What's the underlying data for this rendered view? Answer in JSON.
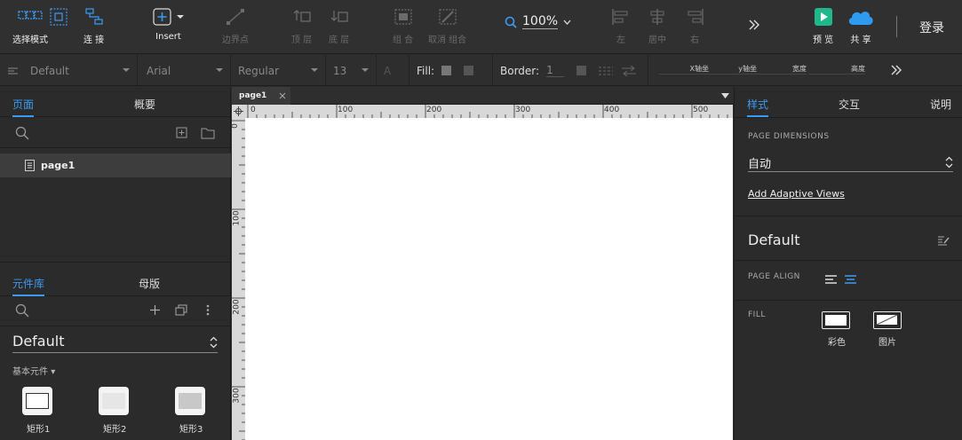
{
  "toolbar": {
    "select_mode": "选择模式",
    "connect": "连 接",
    "insert": "Insert",
    "boundary": "边界点",
    "top_layer": "顶 层",
    "bottom_layer": "底 层",
    "group": "组 合",
    "ungroup": "取消 组合",
    "zoom": "100%",
    "align_left": "左",
    "align_center": "居中",
    "align_right": "右",
    "preview": "预 览",
    "share": "共 享",
    "login": "登录",
    "preview_color": "#1fb88a",
    "share_color": "#2e9bf0"
  },
  "format": {
    "style": "Default",
    "font": "Arial",
    "weight": "Regular",
    "size": "13",
    "font_color_glyph": "A",
    "fill_label": "Fill:",
    "border_label": "Border:",
    "border_value": "1",
    "x_label": "X轴坐",
    "y_label": "y轴坐",
    "w_label": "宽度",
    "h_label": "高度"
  },
  "left": {
    "tab_pages": "页面",
    "tab_outline": "概要",
    "page_item": "page1",
    "tab_library": "元件库",
    "tab_masters": "母版",
    "library_name": "Default",
    "category": "基本元件",
    "widgets": [
      "矩形1",
      "矩形2",
      "矩形3"
    ]
  },
  "canvas": {
    "tab": "page1",
    "ruler_top": [
      "0",
      "100",
      "200",
      "300",
      "400",
      "500"
    ],
    "ruler_left": [
      "0",
      "100",
      "200",
      "300"
    ]
  },
  "right": {
    "tab_style": "样式",
    "tab_interact": "交互",
    "tab_notes": "说明",
    "page_dimensions_label": "PAGE DIMENSIONS",
    "dimension_value": "自动",
    "adaptive_link": "Add Adaptive Views",
    "style_name": "Default",
    "page_align_label": "PAGE ALIGN",
    "fill_label": "FILL",
    "fill_color": "彩色",
    "fill_image": "图片",
    "accent": "#3a9bf3"
  }
}
